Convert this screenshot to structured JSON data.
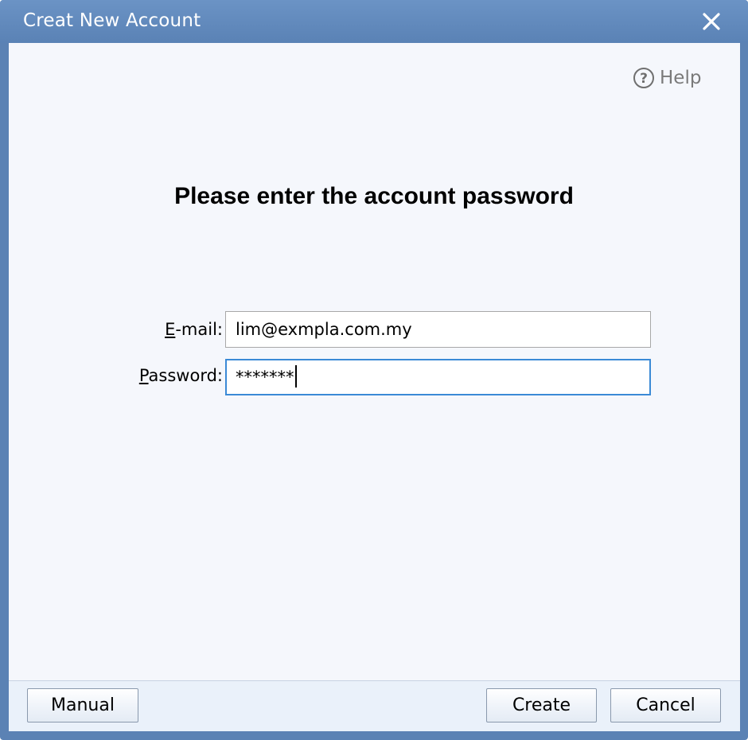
{
  "window": {
    "title": "Creat New Account"
  },
  "help": {
    "label": "Help"
  },
  "heading": "Please enter the account password",
  "form": {
    "email": {
      "label_accel": "E",
      "label_rest": "-mail:",
      "value": "lim@exmpla.com.my"
    },
    "password": {
      "label_accel": "P",
      "label_rest": "assword:",
      "value": "*******"
    }
  },
  "buttons": {
    "manual": "Manual",
    "create": "Create",
    "cancel": "Cancel"
  },
  "icons": {
    "close": "close-icon",
    "help": "help-icon"
  },
  "colors": {
    "titlebar": "#5a82b5",
    "client_bg": "#f5f7fc",
    "focus_border": "#3b8ad6"
  }
}
